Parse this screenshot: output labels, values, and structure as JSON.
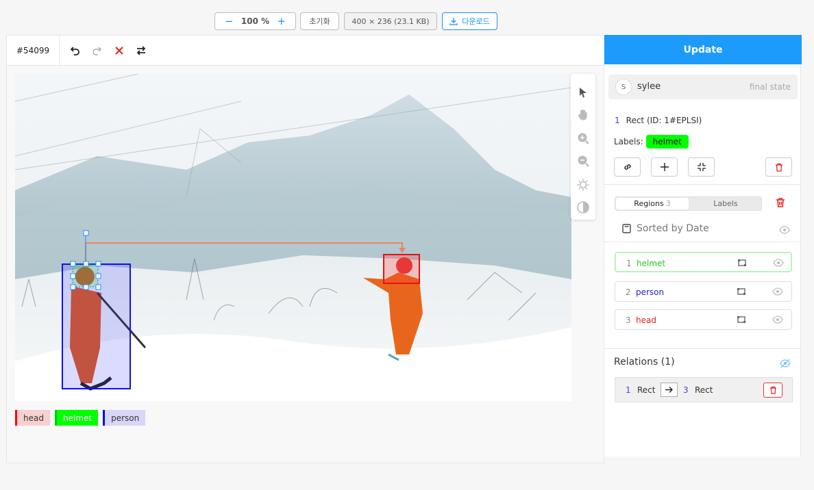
{
  "topbar": {
    "zoom_value": "100 %",
    "reset_label": "초기화",
    "image_info": "400 × 236 (23.1 KB)",
    "download_label": "다운로드"
  },
  "toolbar": {
    "task_id": "#54099",
    "tools": [
      "undo-icon",
      "redo-icon",
      "reject-icon",
      "swap-icon"
    ]
  },
  "canvas_tools": [
    "pointer-icon",
    "hand-icon",
    "zoom-in-icon",
    "zoom-out-icon",
    "brightness-icon",
    "contrast-icon"
  ],
  "legend": [
    {
      "label": "head",
      "color": "#ff0000",
      "bg": "#f9d0d0",
      "text_color": "#333"
    },
    {
      "label": "helmet",
      "color": "#00cc00",
      "bg": "#00ff00",
      "text_color": "#fff"
    },
    {
      "label": "person",
      "color": "#0000ff",
      "bg": "#d6d6f8",
      "text_color": "#333"
    }
  ],
  "sidebar": {
    "update_label": "Update",
    "user": {
      "initial": "S",
      "name": "sylee",
      "state": "final state"
    },
    "selected": {
      "number": "1",
      "title": "Rect (ID: 1#EPLSI)",
      "labels_caption": "Labels:",
      "label": "helmet"
    },
    "tabs": {
      "regions_label": "Regions",
      "regions_count": "3",
      "labels_label": "Labels"
    },
    "sorted_label": "Sorted by Date",
    "regions": [
      {
        "number": "1",
        "label": "helmet",
        "color": "#22cc22"
      },
      {
        "number": "2",
        "label": "person",
        "color": "#2222cc"
      },
      {
        "number": "3",
        "label": "head",
        "color": "#dd2222"
      }
    ],
    "relations_title": "Relations (1)",
    "relation": {
      "from_num": "1",
      "from_type": "Rect",
      "to_num": "3",
      "to_type": "Rect"
    }
  }
}
